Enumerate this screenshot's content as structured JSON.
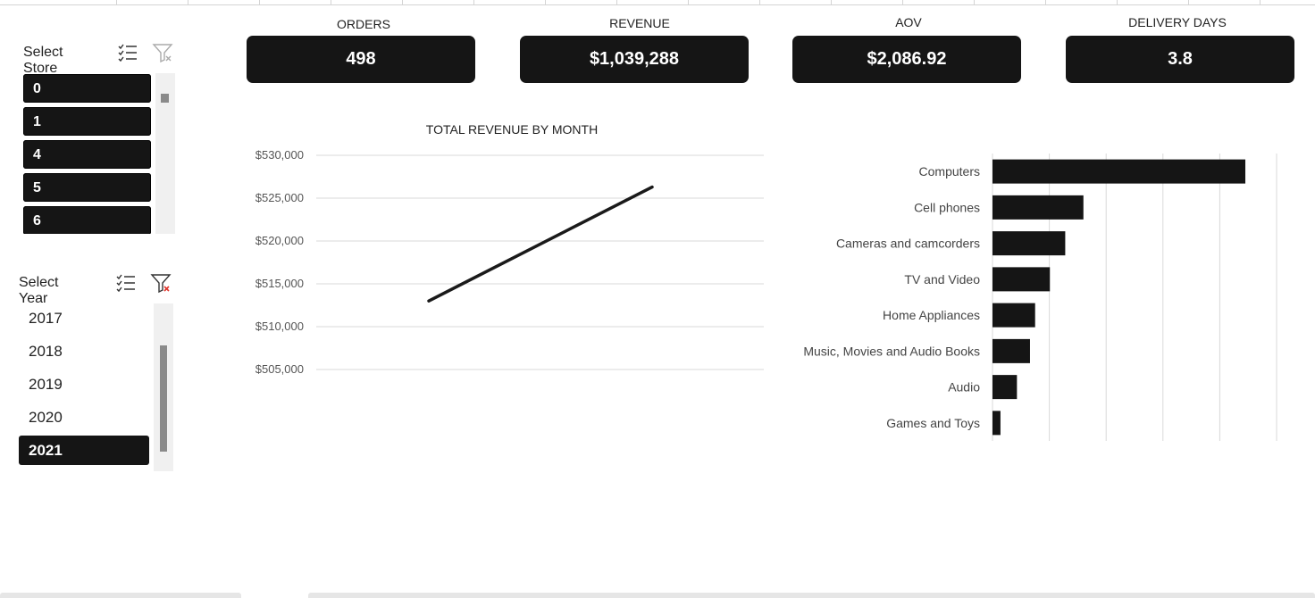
{
  "store_slicer": {
    "title": "Select Store",
    "items": [
      "0",
      "1",
      "4",
      "5",
      "6"
    ]
  },
  "year_slicer": {
    "title": "Select Year",
    "items": [
      "2017",
      "2018",
      "2019",
      "2020",
      "2021"
    ],
    "selected": "2021"
  },
  "kpis": [
    {
      "label": "ORDERS",
      "value": "498"
    },
    {
      "label": "REVENUE",
      "value": "$1,039,288"
    },
    {
      "label": "AOV",
      "value": "$2,086.92"
    },
    {
      "label": "DELIVERY DAYS",
      "value": "3.8"
    }
  ],
  "chart_data": [
    {
      "type": "line",
      "title": "TOTAL REVENUE BY MONTH",
      "yticks": [
        "$505,000",
        "$510,000",
        "$515,000",
        "$520,000",
        "$525,000",
        "$530,000"
      ],
      "ylim": [
        500000,
        530000
      ],
      "series": [
        {
          "values": [
            513000,
            526300
          ]
        }
      ],
      "grid": true
    },
    {
      "type": "bar",
      "orientation": "horizontal",
      "categories": [
        "Computers",
        "Cell phones",
        "Cameras and camcorders",
        "TV and Video",
        "Home Appliances",
        "Music, Movies and Audio Books",
        "Audio",
        "Games and Toys"
      ],
      "values": [
        445,
        160,
        128,
        101,
        75,
        66,
        43,
        14
      ],
      "xlim": [
        0,
        500
      ],
      "grid": true
    }
  ]
}
